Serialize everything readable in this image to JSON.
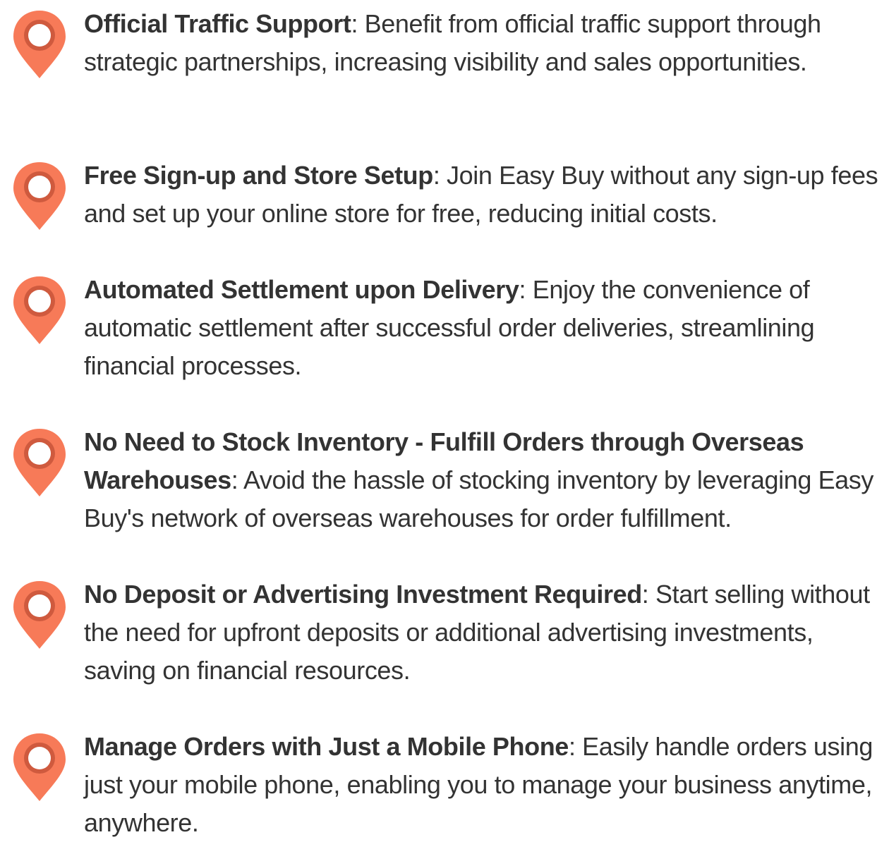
{
  "accent_color": "#f77a58",
  "pin_inner_ring_color": "#cf5a3e",
  "features": [
    {
      "icon": "map-pin-icon",
      "title": "Official Traffic Support",
      "description": ": Benefit from official traffic support through strategic partnerships, increasing visibility and sales opportunities."
    },
    {
      "icon": "map-pin-icon",
      "title": "Free Sign-up and Store Setup",
      "description": ": Join Easy Buy without any sign-up fees and set up your online store for free, reducing initial costs."
    },
    {
      "icon": "map-pin-icon",
      "title": "Automated Settlement upon Delivery",
      "description": ": Enjoy the convenience of automatic settlement after successful order deliveries, streamlining financial processes."
    },
    {
      "icon": "map-pin-icon",
      "title": "No Need to Stock Inventory - Fulfill Orders through Overseas Warehouses",
      "description": ": Avoid the hassle of stocking inventory by leveraging Easy Buy's network of overseas warehouses for order fulfillment."
    },
    {
      "icon": "map-pin-icon",
      "title": "No Deposit or Advertising Investment Required",
      "description": ": Start selling without the need for upfront deposits or additional advertising investments, saving on financial resources."
    },
    {
      "icon": "map-pin-icon",
      "title": "Manage Orders with Just a Mobile Phone",
      "description": ": Easily handle orders using just your mobile phone, enabling you to manage your business anytime, anywhere."
    }
  ]
}
